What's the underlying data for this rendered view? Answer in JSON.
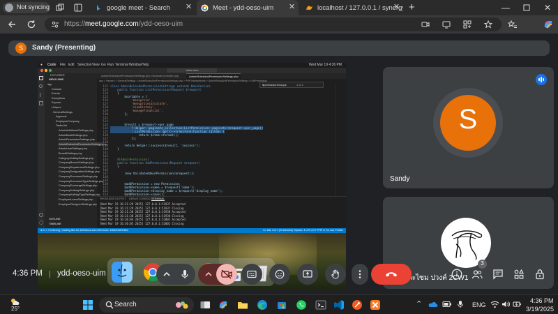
{
  "browser": {
    "profile_label": "Not syncing",
    "tabs": [
      {
        "title": "google meet - Search",
        "favicon": "bing-search-icon",
        "active": false
      },
      {
        "title": "Meet - ydd-oeso-uim",
        "favicon": "google-meet-icon",
        "active": true
      },
      {
        "title": "localhost / 127.0.0.1 / synergy202",
        "favicon": "phpmyadmin-icon",
        "active": false
      }
    ],
    "new_tab_label": "+",
    "url": "https://meet.google.com/ydd-oeso-uim",
    "url_scheme": "https://",
    "url_host": "meet.google.com",
    "url_path": "/ydd-oeso-uim"
  },
  "meet": {
    "presenter_initial": "S",
    "presenter_label": "Sandy (Presenting)",
    "participants": [
      {
        "name": "Sandy",
        "initial": "S",
        "avatar_color": "#e8710a",
        "speaking": true
      },
      {
        "name": "ท.เบ้ดละไซม ปวงค์ 2CW1",
        "avatar": "signature-drawing",
        "speaking": false
      }
    ],
    "time": "4:36 PM",
    "separator": "|",
    "meeting_code": "ydd-oeso-uim",
    "people_count": "3",
    "colors": {
      "end_call": "#ea4335",
      "camera_off": "#5c2b29",
      "accent_blue": "#1a73e8",
      "tile_bg": "#3c4043"
    }
  },
  "shared_screen": {
    "menubar": {
      "app_menus": [
        "Code",
        "File",
        "Edit",
        "Selection",
        "View",
        "Go",
        "Run",
        "Terminal",
        "Window",
        "Help"
      ],
      "clock": "Wed Mar 19 4:36 PM"
    },
    "vscode": {
      "search_text": "nifax-oms",
      "tabs": [
        "AdminRolesAndPermissionSettings.php",
        "GeneralController.php",
        "AdminRolesAndPermissionSettings.php"
      ],
      "active_tab": "AdminRolesAndPermissionSettings.php",
      "breadcrumb": "app > Helpers > GeneralSettings > AdminRolesAndPermissionSettings.php > PHP Intelephense > AdminRolesAndPermissionSettings > EditPermission",
      "find_widget": "$permissionGroups",
      "find_count": "1 of 1",
      "explorer_title": "EXPLORER",
      "explorer_root": "NIFAX-OMS",
      "explorer_items": [
        "app",
        "Console",
        "Events",
        "Exceptions",
        "Exports",
        "Helpers",
        "GeneralSettings",
        "Approval",
        "EmployeeCompany",
        "TasksList",
        "AdminAdditionalSettings.php",
        "AdminBankSettings.php",
        "AdminPermissionSettings.php",
        "AdminRolesAndPermissionSettings.php",
        "AdminUserSettings.php",
        "BenefitSettings.php",
        "CategoryHolidaySettings.php",
        "CompanyBranchSettings.php",
        "CompanyDepartmentSettings.php",
        "CompanyDesignationSettings.php",
        "CompanyDocumentSettings.php",
        "CompanyDocumentTypeSettings.php",
        "CompanyExchangeSettings.php",
        "CompanyHolidaySettings.php",
        "CompanyHolidayTypeSettings.php",
        "EmployeeLeaveSettings.php",
        "EmployeeResignedSettings.php"
      ],
      "outline_label": "OUTLINE",
      "timeline_label": "TIMELINE",
      "line_numbers": [
        "122",
        "123",
        "124",
        "125",
        "126",
        "127",
        "128",
        "129",
        "130",
        "131",
        "132",
        "133",
        "134",
        "135",
        "136",
        "137",
        "138",
        "139",
        "140",
        "141",
        "142",
        "143",
        "144",
        "145",
        "146",
        "147",
        "148",
        "149",
        "150",
        "151",
        "152",
        "153"
      ],
      "code_lines": [
        "class AdminRolesAndPermissionSettings extends BaseService",
        "    public function ListPermission(Request $request)",
        "    {",
        "        $sortable = [",
        "            'menuprice',",
        "            'menupricecalculate',",
        "            'viewhistory',",
        "            'managefinancial',",
        "        ];",
        "",
        "",
        "        $result = $request->per_page",
        "            ? Helper::paginate_collection(ListPermission::paginate($request->per_page))",
        "            : ListPermission::get()->transform(function ($item) {",
        "                return $item->format();",
        "            });",
        "",
        "        return Helper::success($result, 'success');",
        "    }",
        "",
        "",
        "    #[AdminPermission]",
        "    public function AddPermission(Request $request)",
        "    {",
        "",
        "        (new ValidateAdminPermission($request));",
        "",
        "",
        "        $addPermission = new Permission;",
        "        $addPermission->name = $request('name');",
        "        $addPermission->display_name = $request('display_name');",
        "        $addPermission->save();"
      ],
      "panel_tabs": [
        "PROBLEMS",
        "OUTPUT",
        "DEBUG CONSOLE",
        "TERMINAL"
      ],
      "active_panel_tab": "TERMINAL",
      "terminal_lines": [
        "[Wed Mar 19 16:21:29 2025] 127.0.0.1:51937 Accepted",
        "[Wed Mar 19 16:21:29 2025] 127.0.0.1:51937 Closing",
        "[Wed Mar 19 16:21:30 2025] 127.0.0.1:51938 Accepted",
        "[Wed Mar 19 16:21:30 2025] 127.0.0.1:51938 Closing",
        "[Wed Mar 19 16:36:04 2025] 127.0.0.1:52001 Accepted",
        "[Wed Mar 19 16:36:05 2025] 127.0.0.1:52001 Closing"
      ],
      "status_left": "⊗ 0 ⚠ 0   Indexing | reading files for definitions and references: 1062/10203 files",
      "status_right": "Ln 136, Col 7 (23 selected)   Spaces: 4   UTF-8   LF   PHP   ⊖ Go Live   Prettier"
    },
    "dock_apps": [
      "finder-icon",
      "chrome-icon",
      "vscode-icon",
      "postman-icon",
      "preview-icon",
      "trash-icon"
    ]
  },
  "taskbar": {
    "weather": "25°",
    "search_placeholder": "Search",
    "pinned_apps": [
      "task-view-icon",
      "file-explorer-icon",
      "edge-icon",
      "microsoft-store-icon",
      "whatsapp-icon",
      "terminal-icon",
      "vscode-icon",
      "postman-icon",
      "xampp-icon"
    ],
    "language": "ENG",
    "time": "4:36 PM",
    "date": "3/19/2025"
  }
}
